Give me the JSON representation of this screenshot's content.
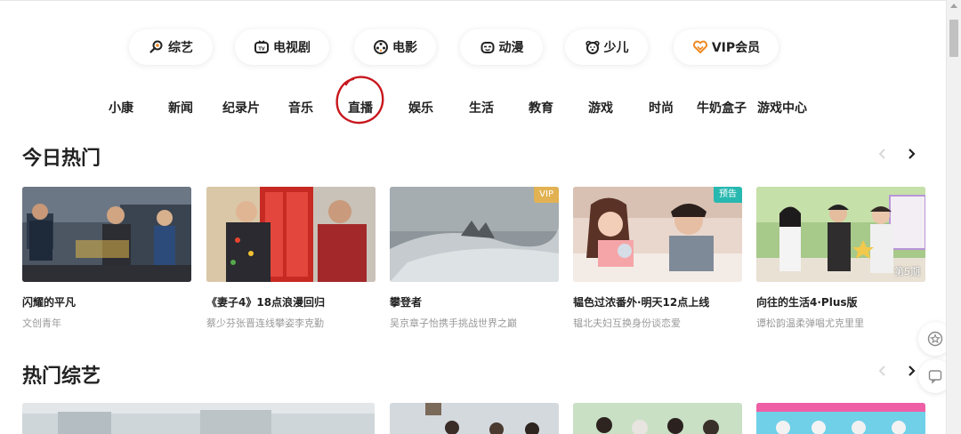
{
  "top_categories": [
    {
      "label": "综艺",
      "icon": "search-icon"
    },
    {
      "label": "电视剧",
      "icon": "tv-icon"
    },
    {
      "label": "电影",
      "icon": "film-reel-icon"
    },
    {
      "label": "动漫",
      "icon": "anime-face-icon"
    },
    {
      "label": "少儿",
      "icon": "bear-icon"
    },
    {
      "label": "VIP会员",
      "icon": "vip-heart-icon",
      "accent": "#f08a24"
    }
  ],
  "sub_nav": [
    "小康",
    "新闻",
    "纪录片",
    "音乐",
    "直播",
    "娱乐",
    "生活",
    "教育",
    "游戏",
    "时尚",
    "牛奶盒子",
    "游戏中心"
  ],
  "annotation": {
    "circled_item": "直播",
    "color": "#c8161d"
  },
  "sections": {
    "today_hot": {
      "title": "今日热门",
      "cards": [
        {
          "title": "闪耀的平凡",
          "subtitle": "文创青年",
          "badge": "",
          "episode": ""
        },
        {
          "title": "《妻子4》18点浪漫回归",
          "subtitle": "蔡少芬张晋连线攀姿李克勤",
          "badge": "",
          "episode": ""
        },
        {
          "title": "攀登者",
          "subtitle": "吴京章子怡携手挑战世界之巅",
          "badge": "VIP",
          "episode": ""
        },
        {
          "title": "韫色过浓番外·明天12点上线",
          "subtitle": "韫北夫妇互换身份谈恋爱",
          "badge": "预告",
          "episode": ""
        },
        {
          "title": "向往的生活4·Plus版",
          "subtitle": "谭松韵温柔弹唱尤克里里",
          "badge": "",
          "episode": "第5期"
        }
      ]
    },
    "hot_variety": {
      "title": "热门综艺"
    }
  },
  "colors": {
    "vip_badge": "#e2b252",
    "preview_badge": "#27b8b0",
    "accent": "#f08a24"
  },
  "side_buttons": [
    {
      "icon": "star-badge-icon"
    },
    {
      "icon": "chat-bubble-icon"
    }
  ]
}
